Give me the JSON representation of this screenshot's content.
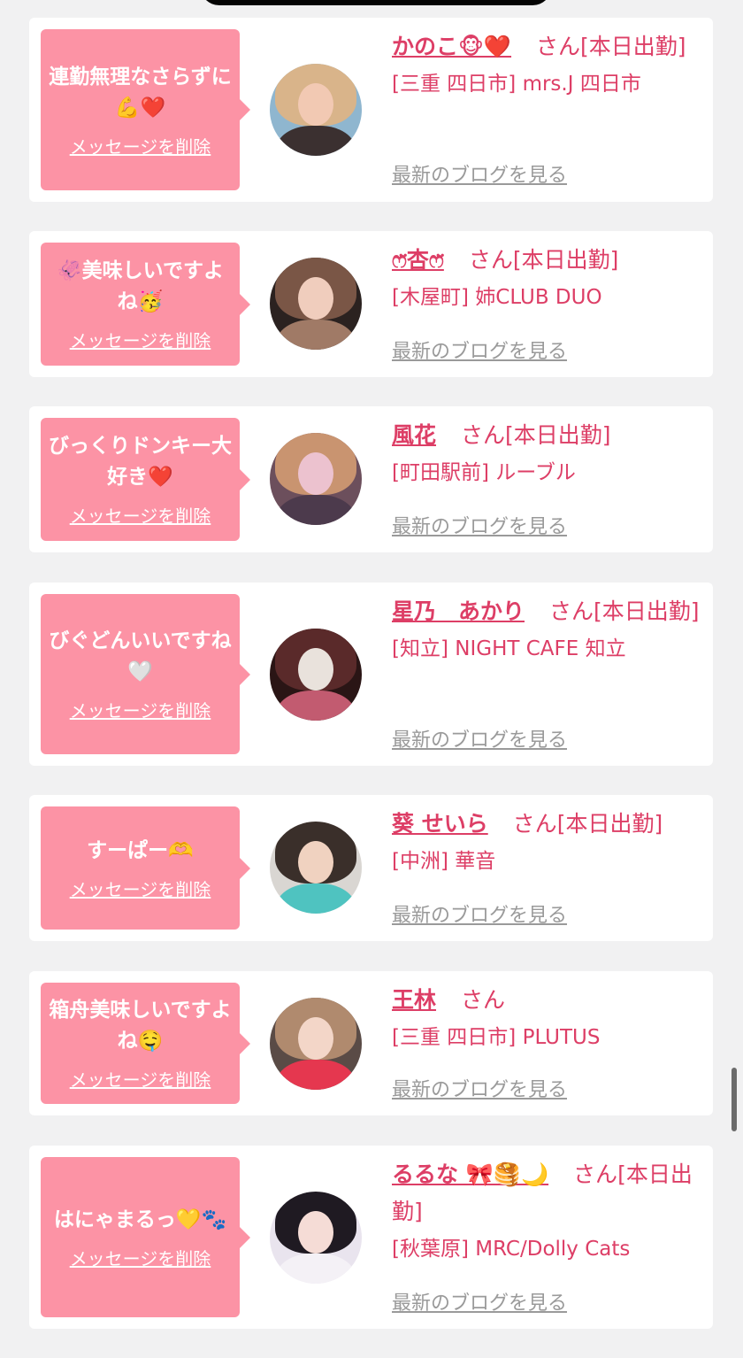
{
  "delete_label": "メッセージを削除",
  "blog_label": "最新のブログを見る",
  "colors": {
    "bubble": "#fc93a5",
    "accent": "#dd3e66",
    "blog_link": "#9a9a9a",
    "background": "#f1f1f2"
  },
  "cards": [
    {
      "message": "連勤無理なさらずに💪❤️",
      "name": "かのこ🐵❤️",
      "san": "さん",
      "status": "[本日出勤]",
      "shop": "[三重 四日市] mrs.J 四日市",
      "avatar_icon": "avatar-photo-blonde-woman"
    },
    {
      "message": "🦑美味しいですよね🥳",
      "name": "ෆ̈杏ෆ̈",
      "san": "さん",
      "status": "[本日出勤]",
      "shop": "[木屋町] 姉CLUB DUO",
      "avatar_icon": "avatar-photo-heart-sticker-face"
    },
    {
      "message": "びっくりドンキー大好き❤️",
      "name": "風花",
      "san": "さん",
      "status": "[本日出勤]",
      "shop": "[町田駅前] ルーブル",
      "avatar_icon": "avatar-photo-selfie"
    },
    {
      "message": "びぐどんいいですね🤍",
      "name": "星乃　あかり",
      "san": "さん",
      "status": "[本日出勤]",
      "shop": "[知立] NIGHT CAFE 知立",
      "avatar_icon": "avatar-photo-gloved-hands"
    },
    {
      "message": "すーぱー🫶",
      "name": "葵 せいら",
      "san": "さん",
      "status": "[本日出勤]",
      "shop": "[中洲] 華音",
      "avatar_icon": "avatar-photo-teal-shirt"
    },
    {
      "message": "箱舟美味しいですよね🤤",
      "name": "王林",
      "san": "さん",
      "status": "",
      "shop": "[三重 四日市] PLUTUS",
      "avatar_icon": "avatar-photo-apple"
    },
    {
      "message": "はにゃまるっ💛🐾",
      "name": "るるな 🎀🥞🌙",
      "san": "さん",
      "status": "[本日出勤]",
      "shop": "[秋葉原] MRC/Dolly Cats",
      "avatar_icon": "avatar-photo-idol-outfit"
    }
  ]
}
